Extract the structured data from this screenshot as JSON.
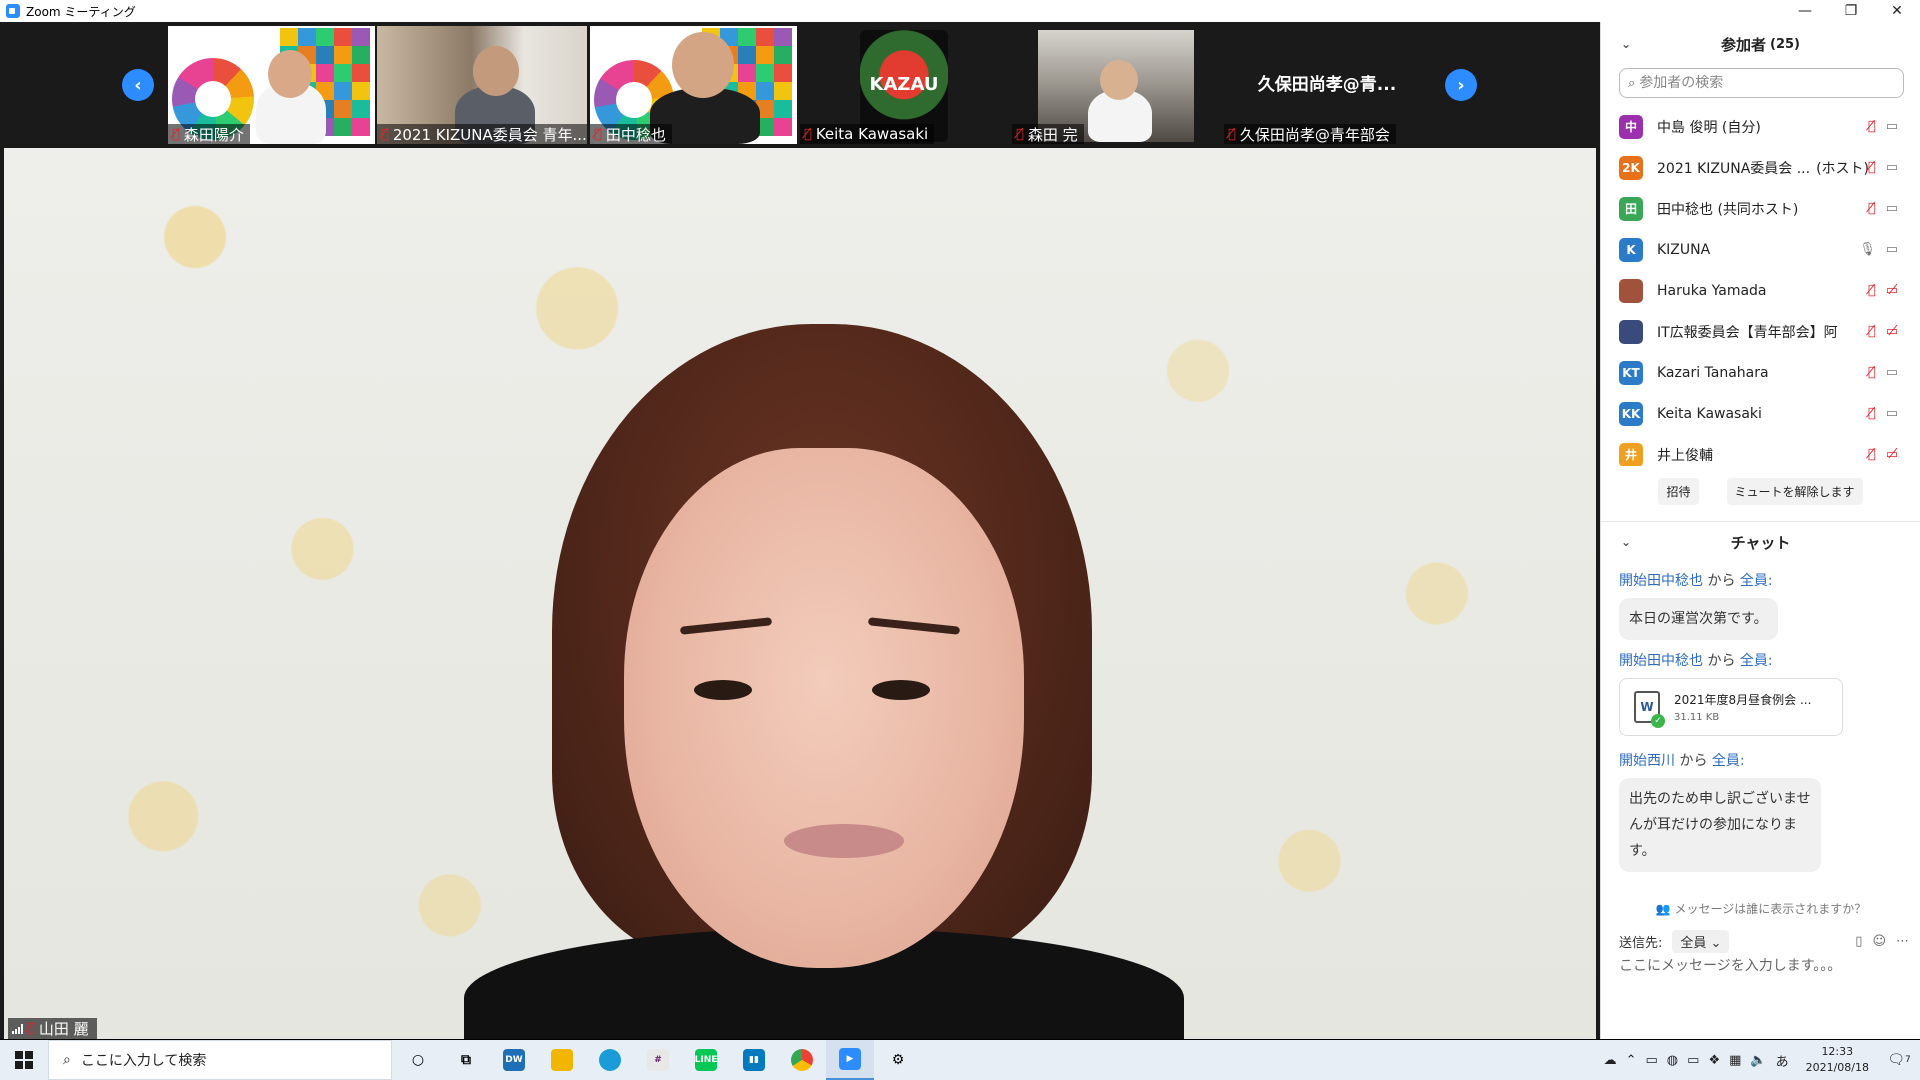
{
  "window": {
    "title": "Zoom ミーティング",
    "controls": {
      "minimize": "—",
      "restore": "❐",
      "close": "✕"
    }
  },
  "thumbnails": [
    {
      "name": "森田陽介",
      "muted": true
    },
    {
      "name": "2021 KIZUNA委員会 青年...",
      "muted": true
    },
    {
      "name": "田中稔也",
      "muted": true
    },
    {
      "name": "Keita Kawasaki",
      "muted": true,
      "logo_text": "KAZAU"
    },
    {
      "name": "森田 完",
      "muted": true
    },
    {
      "name": "久保田尚孝@青年部会",
      "muted": true,
      "display_name": "久保田尚孝@青..."
    }
  ],
  "speaker": {
    "name": "山田 麗",
    "muted": true
  },
  "participants_panel": {
    "title": "参加者",
    "count": "(25)",
    "search_placeholder": "参加者の検索",
    "participants": [
      {
        "initials": "中",
        "color": "#9b2fae",
        "name": "中島 俊明 (自分)",
        "tag": "",
        "mic": "off",
        "cam": "on"
      },
      {
        "initials": "2K",
        "color": "#e8721c",
        "name": "2021 KIZUNA委員会 ...",
        "tag": "(ホスト)",
        "mic": "off",
        "cam": "on"
      },
      {
        "initials": "田",
        "color": "#3aa757",
        "name": "田中稔也 (共同ホスト)",
        "tag": "",
        "mic": "off",
        "cam": "on"
      },
      {
        "initials": "K",
        "color": "#2b7bc8",
        "name": "KIZUNA",
        "tag": "",
        "mic": "on",
        "cam": "on"
      },
      {
        "initials": "",
        "color": "#a0523d",
        "name": "Haruka Yamada",
        "tag": "",
        "mic": "off",
        "cam": "off"
      },
      {
        "initials": "",
        "color": "#3a4a7a",
        "name": "IT広報委員会【青年部会】阿",
        "tag": "",
        "mic": "off",
        "cam": "off"
      },
      {
        "initials": "KT",
        "color": "#2b7bc8",
        "name": "Kazari Tanahara",
        "tag": "",
        "mic": "off",
        "cam": "on"
      },
      {
        "initials": "KK",
        "color": "#2b7bc8",
        "name": "Keita Kawasaki",
        "tag": "",
        "mic": "off",
        "cam": "on"
      },
      {
        "initials": "井",
        "color": "#f0a020",
        "name": "井上俊輔",
        "tag": "",
        "mic": "off",
        "cam": "off"
      }
    ],
    "invite_label": "招待",
    "unmute_label": "ミュートを解除します"
  },
  "chat_panel": {
    "title": "チャット",
    "messages": [
      {
        "prefix": "開始",
        "from": "田中稔也",
        "mid": " から ",
        "to": "全員",
        "suffix": ":",
        "text": "本日の運営次第です。"
      },
      {
        "prefix": "開始",
        "from": "田中稔也",
        "mid": " から ",
        "to": "全員",
        "suffix": ":",
        "file": {
          "name": "2021年度8月昼食例会 ...",
          "size": "31.11 KB",
          "icon_letter": "W"
        }
      },
      {
        "prefix": "開始",
        "from": "西川",
        "mid": " から ",
        "to": "全員",
        "suffix": ":",
        "text_lines": [
          "出先のため申し訳ございませ",
          "んが耳だけの参加になりま",
          "す。"
        ]
      }
    ],
    "who_sees": "メッセージは誰に表示されますか？",
    "send_to_label": "送信先:",
    "send_to_value": "全員",
    "input_placeholder": "ここにメッセージを入力します。。。"
  },
  "taskbar": {
    "search_placeholder": "ここに入力して検索",
    "apps": [
      "task-view",
      "dw",
      "explorer",
      "edge",
      "slack",
      "line",
      "trello",
      "chrome",
      "zoom",
      "settings"
    ],
    "ime": "あ",
    "time": "12:33",
    "date": "2021/08/18",
    "notif_count": "7"
  }
}
